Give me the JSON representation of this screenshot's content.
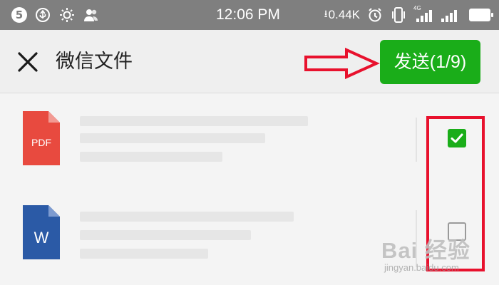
{
  "status_bar": {
    "notification_count": "5",
    "time": "12:06 PM",
    "net_speed": "0.44K",
    "network_type": "4G",
    "icons": [
      "usb-icon",
      "brightness-icon",
      "contacts-icon",
      "download-arrow-icon",
      "alarm-icon",
      "vibrate-icon",
      "signal-icon",
      "battery-icon"
    ]
  },
  "app_bar": {
    "title": "微信文件",
    "send_label": "发送(1/9)",
    "close_icon": "close-icon"
  },
  "files": [
    {
      "type_label": "PDF",
      "icon": "pdf-file-icon",
      "icon_color": "#e84a3f",
      "checked": true
    },
    {
      "type_label": "W",
      "icon": "word-file-icon",
      "icon_color": "#2b5aa6",
      "checked": false
    }
  ],
  "colors": {
    "accent": "#1aad19",
    "annotation": "#e8112d",
    "status_bar": "#7f7f7f"
  },
  "watermark": {
    "text": "Bai 经验",
    "sub": "jingyan.baidu.com"
  }
}
